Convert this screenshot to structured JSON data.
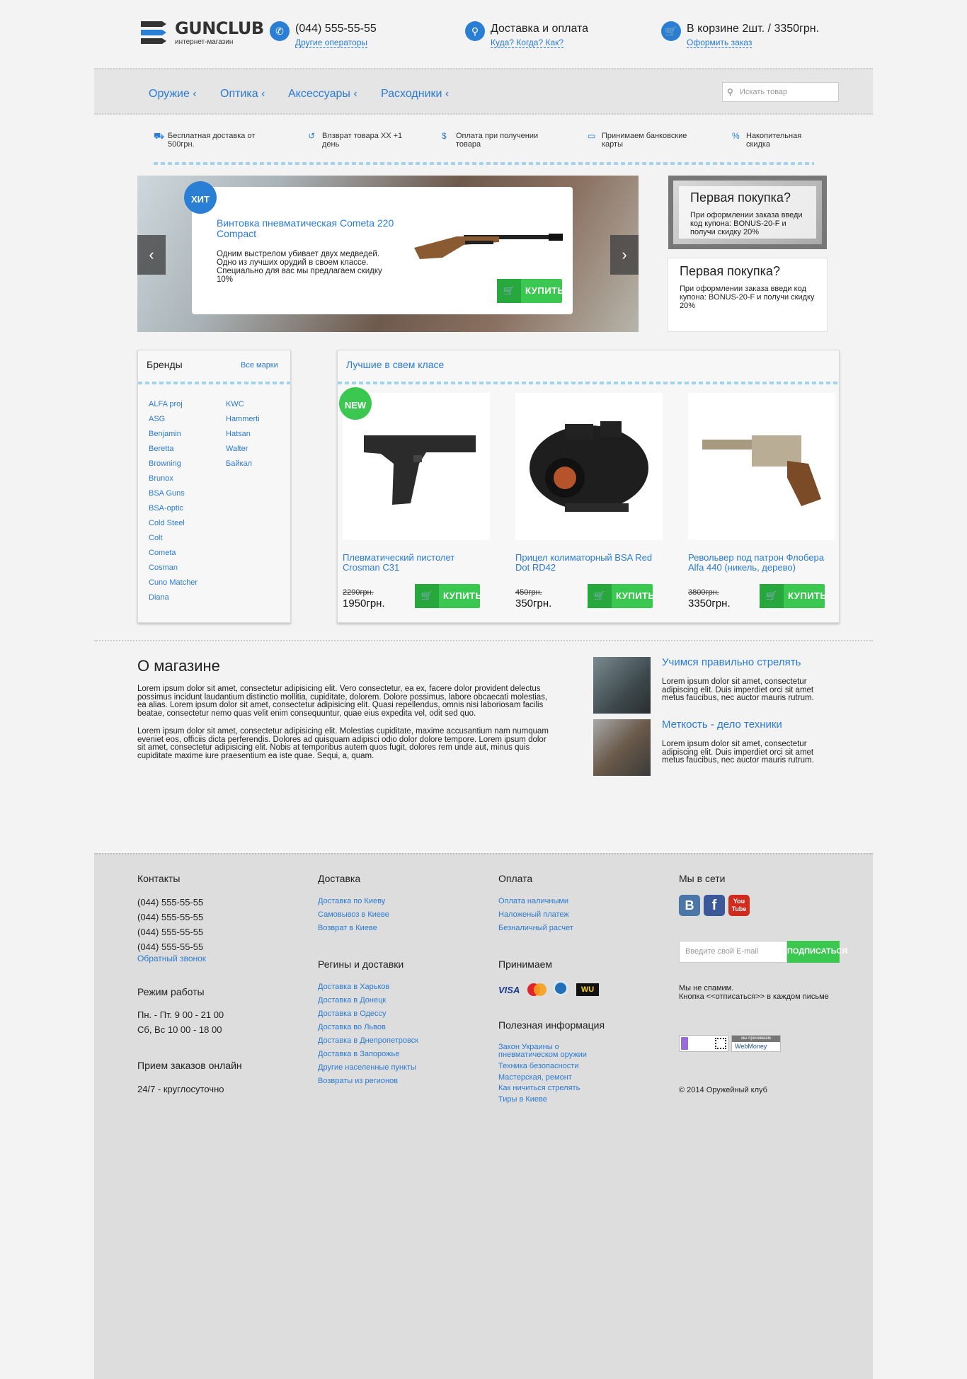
{
  "header": {
    "logo_title": "GUNCLUB",
    "logo_subtitle": "интернет-магазин",
    "phone": "(044) 555-55-55",
    "phone_link": "Другие операторы",
    "delivery_title": "Доставка и оплата",
    "delivery_link": "Куда? Когда? Как?",
    "cart_title": "В корзине 2шт. / 3350грн.",
    "cart_link": "Оформить заказ"
  },
  "nav": {
    "items": [
      "Оружие ‹",
      "Оптика ‹",
      "Аксессуары ‹",
      "Расходники ‹"
    ],
    "search_placeholder": "Искать товар"
  },
  "features": [
    "Бесплатная доставка от 500грн.",
    "Влзврат товара XX +1 день",
    "Оплата при получении товара",
    "Принимаем банковские карты",
    "Накопительная скидка"
  ],
  "slider": {
    "badge": "ХИТ",
    "title": "Винтовка пневматическая Cometa 220 Compact",
    "description": "Одним выстрелом убивает двух медведей. Одно из лучших орудий в своем классе. Специально для вас мы предлагаем скидку 10%",
    "buy_label": "КУПИТЬ"
  },
  "promos": [
    {
      "title": "Первая покупка?",
      "text": "При оформлении заказа введи код купона: BONUS-20-F и получи скидку 20%"
    },
    {
      "title": "Первая покупка?",
      "text": "При оформлении заказа введи код купона: BONUS-20-F и получи скидку 20%"
    }
  ],
  "brands": {
    "title": "Бренды",
    "all_link": "Все марки",
    "col1": [
      "ALFA proj",
      "ASG",
      "Benjamin",
      "Beretta",
      "Browning",
      "Brunox",
      "BSA Guns",
      "BSA-optic",
      "Cold Steel",
      "Colt",
      "Cometa",
      "Cosman",
      "Cuno Matcher",
      "Diana"
    ],
    "col2": [
      "KWC",
      "Hammerti",
      "Hatsan",
      "Walter",
      "Байкал"
    ]
  },
  "best": {
    "title": "Лучшие в свем класе",
    "new_badge": "NEW",
    "products": [
      {
        "title": "Плевматический пистолет Crosman C31",
        "old_price": "2290грн.",
        "price": "1950грн.",
        "buy": "КУПИТЬ"
      },
      {
        "title": "Прицел колиматорный BSA Red Dot RD42",
        "old_price": "450грн.",
        "price": "350грн.",
        "buy": "КУПИТЬ"
      },
      {
        "title": "Револьвер под патрон Флобера Alfa 440 (никель, дерево)",
        "old_price": "3800грн.",
        "price": "3350грн.",
        "buy": "КУПИТЬ"
      }
    ]
  },
  "about": {
    "title": "О магазине",
    "p1": "Lorem ipsum dolor sit amet, consectetur adipisicing elit. Vero consectetur, ea ex, facere dolor provident delectus possimus incidunt laudantium distinctio mollitia, cupiditate, dolorem. Dolore possimus, labore obcaecati molestias, ea alias. Lorem ipsum dolor sit amet, consectetur adipisicing elit. Quasi repellendus, omnis nisi laboriosam facilis beatae, consectetur nemo quas velit enim consequuntur, quae eius expedita vel, odit sed quo.",
    "p2": "Lorem ipsum dolor sit amet, consectetur adipisicing elit. Molestias cupiditate, maxime accusantium nam numquam eveniet eos, officiis dicta perferendis. Dolores ad quisquam adipisci odio dolor dolore tempore. Lorem ipsum dolor sit amet, consectetur adipisicing elit. Nobis at temporibus autem quos fugit, dolores rem unde aut, minus quis cupiditate maxime iure praesentium ea iste quae. Sequi, a, quam."
  },
  "articles": [
    {
      "title": "Учимся правильно стрелять",
      "text": "Lorem ipsum dolor sit amet, consectetur adipiscing elit. Duis imperdiet orci sit amet metus faucibus, nec auctor mauris rutrum."
    },
    {
      "title": "Меткость - дело техники",
      "text": "Lorem ipsum dolor sit amet, consectetur adipiscing elit. Duis imperdiet orci sit amet metus faucibus, nec auctor mauris rutrum."
    }
  ],
  "footer": {
    "contacts_title": "Контакты",
    "phones": [
      "(044) 555-55-55",
      "(044) 555-55-55",
      "(044) 555-55-55",
      "(044) 555-55-55"
    ],
    "callback": "Обратный звонок",
    "hours_title": "Режим работы",
    "hours": [
      "Пн. - Пт. 9 00 - 21 00",
      "Сб, Вс 10 00 - 18 00"
    ],
    "online_title": "Прием заказов онлайн",
    "online_text": "24/7 - круглосуточно",
    "delivery_title": "Доставка",
    "delivery_links": [
      "Доставка по Киеву",
      "Самовывоз в Киеве",
      "Возврат в Киеве"
    ],
    "regions_title": "Регины и доставки",
    "region_links": [
      "Доставка в Харьков",
      "Доставка в Донецк",
      "Доставка в Одессу",
      "Доставка во Львов",
      "Доставка в Днепропетровск",
      "Доставка в Запорожье",
      "Другие населенные пункты",
      "Возвраты из регионов"
    ],
    "payment_title": "Оплата",
    "payment_links": [
      "Оплата наличными",
      "Наложеный платеж",
      "Безналичный расчет"
    ],
    "accept_title": "Принимаем",
    "accept_logos": [
      "VISA",
      "mastercard",
      "webmoney",
      "WU"
    ],
    "info_title": "Полезная информация",
    "info_links": [
      "Закон Украины о пневматическом оружии",
      "Техника безопасности",
      "Мастерская, ремонт",
      "Как ничиться стрелять",
      "Тиры в Киеве"
    ],
    "social_title": "Мы в сети",
    "social": [
      "B",
      "f",
      "You Tube"
    ],
    "email_placeholder": "Введите свой E-mail",
    "subscribe": "ПОДПИСАТЬСЯ",
    "spam_note": "Мы не спамим.\nКнопка <<отписаться>> в каждом письме",
    "webmoney_top": "мы принимаем",
    "webmoney": "WebMoney",
    "copyright": "© 2014 Оружейный клуб"
  }
}
